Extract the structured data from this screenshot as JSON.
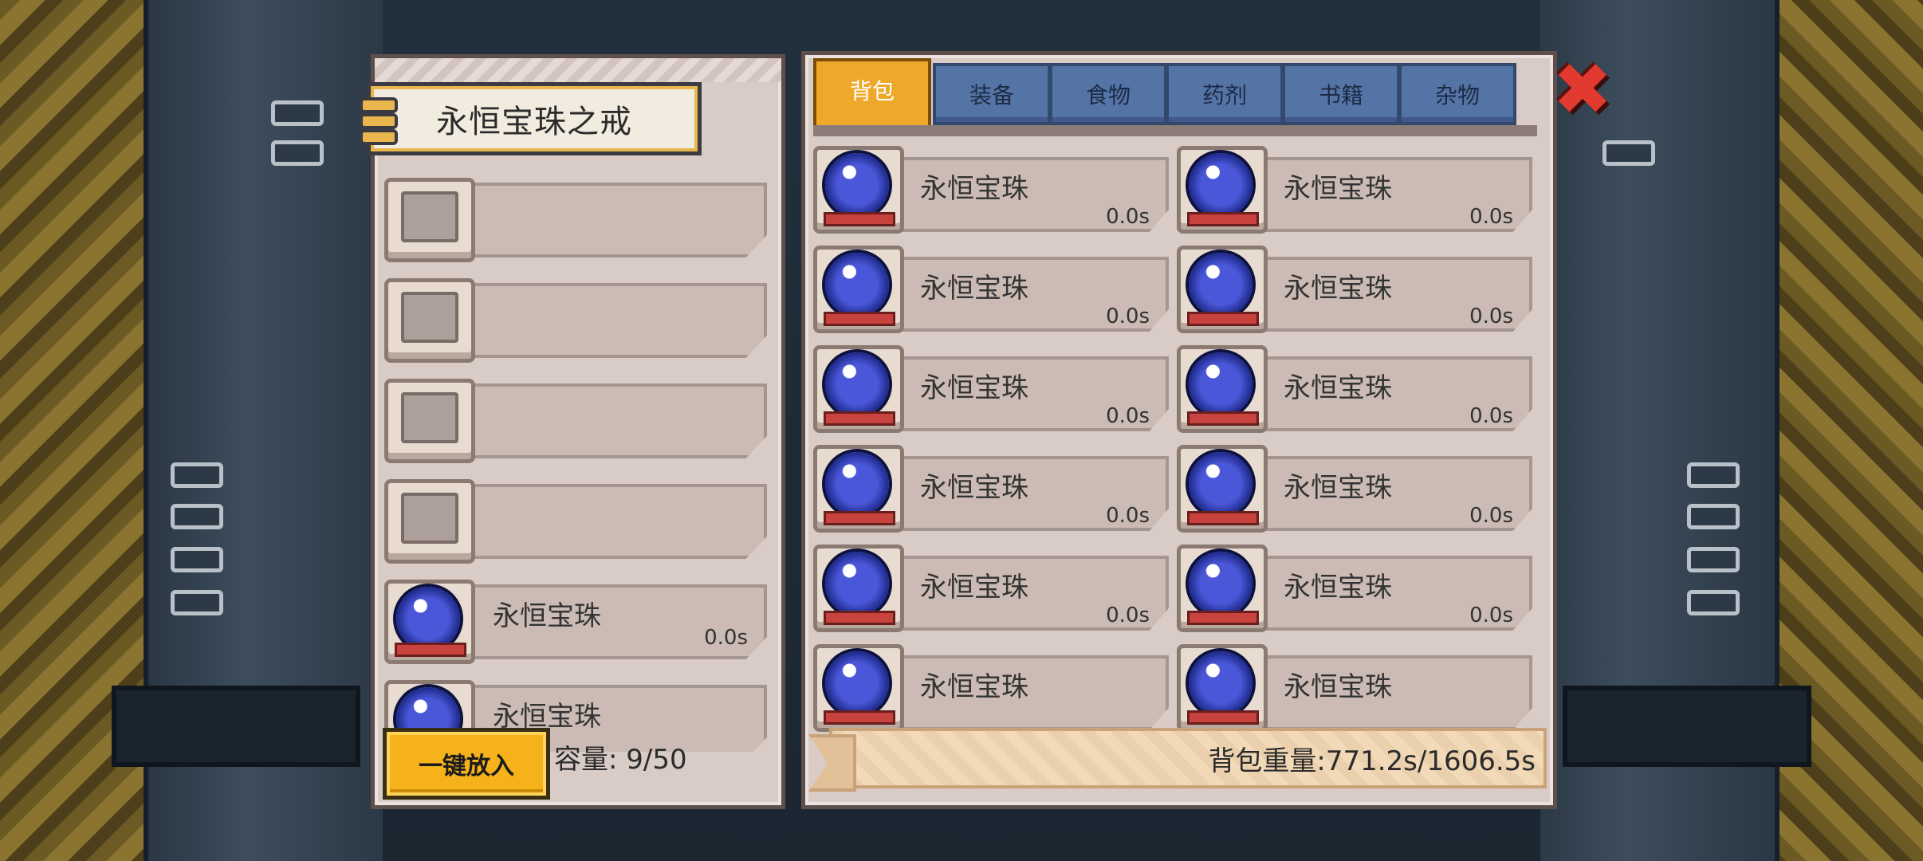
{
  "container": {
    "title": "永恒宝珠之戒",
    "slots": [
      {
        "empty": true
      },
      {
        "empty": true
      },
      {
        "empty": true
      },
      {
        "empty": true
      },
      {
        "empty": false,
        "name": "永恒宝珠",
        "weight": "0.0s"
      },
      {
        "empty": false,
        "name": "永恒宝珠",
        "weight": ""
      }
    ],
    "put_all_label": "一键放入",
    "capacity": "容量: 9/50"
  },
  "inventory": {
    "tabs": [
      {
        "label": "背包",
        "active": true
      },
      {
        "label": "装备",
        "active": false
      },
      {
        "label": "食物",
        "active": false
      },
      {
        "label": "药剂",
        "active": false
      },
      {
        "label": "书籍",
        "active": false
      },
      {
        "label": "杂物",
        "active": false
      }
    ],
    "items": [
      {
        "name": "永恒宝珠",
        "weight": "0.0s"
      },
      {
        "name": "永恒宝珠",
        "weight": "0.0s"
      },
      {
        "name": "永恒宝珠",
        "weight": "0.0s"
      },
      {
        "name": "永恒宝珠",
        "weight": "0.0s"
      },
      {
        "name": "永恒宝珠",
        "weight": "0.0s"
      },
      {
        "name": "永恒宝珠",
        "weight": "0.0s"
      },
      {
        "name": "永恒宝珠",
        "weight": "0.0s"
      },
      {
        "name": "永恒宝珠",
        "weight": "0.0s"
      },
      {
        "name": "永恒宝珠",
        "weight": "0.0s"
      },
      {
        "name": "永恒宝珠",
        "weight": "0.0s"
      },
      {
        "name": "永恒宝珠",
        "weight": ""
      },
      {
        "name": "永恒宝珠",
        "weight": ""
      }
    ],
    "bag_weight": "背包重量:771.2s/1606.5s"
  },
  "icons": {
    "close": "close-icon",
    "orb": "blue-orb-icon"
  },
  "colors": {
    "active_tab": "#efa92a",
    "inactive_tab": "#5574a6",
    "close": "#e23a30",
    "put_all_button": "#f5b21a"
  }
}
